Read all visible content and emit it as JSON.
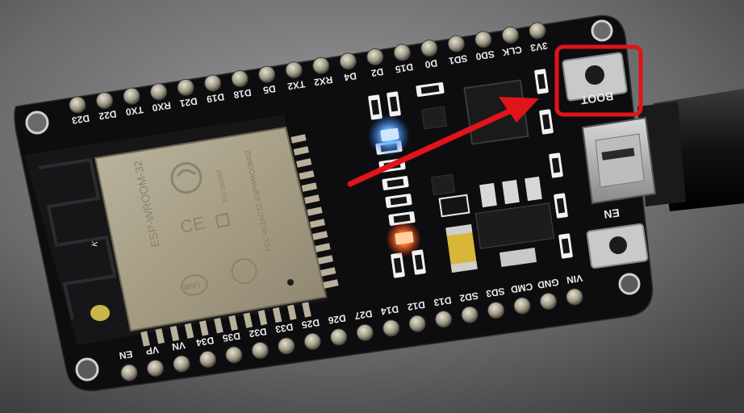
{
  "board": {
    "top_pins": [
      "D23",
      "D22",
      "TX0",
      "RX0",
      "D21",
      "D19",
      "D18",
      "D5",
      "TX2",
      "RX2",
      "D4",
      "D2",
      "D15",
      "D0",
      "SD1",
      "SD0",
      "CLK",
      "3V3"
    ],
    "bottom_pins": [
      "EN",
      "VP",
      "VN",
      "D34",
      "D35",
      "D32",
      "D33",
      "D25",
      "D26",
      "D27",
      "D14",
      "D12",
      "D13",
      "SD2",
      "SD3",
      "CMD",
      "GND",
      "VIN"
    ],
    "boot_button_label": "BOOT",
    "en_button_label": "EN",
    "module_label": "ESP-WROOM-32",
    "module_fcc_id": "FCC ID:2AC7Z-ESPWROOM32",
    "module_model_code": "211-161007",
    "wifi_logo_text": "WiFi",
    "antenna_marker": "K"
  },
  "annotation": {
    "highlight_target": "boot-button",
    "highlight_color": "#e0141a",
    "arrow_color": "#e0141a"
  },
  "colors": {
    "background": "#5a5a5c",
    "pcb": "#0d0d0f",
    "module_shield": "#a79f86",
    "silkscreen": "#e8e8e8",
    "blue_led": "#4aa8ff",
    "red_led": "#ff5a2a"
  }
}
